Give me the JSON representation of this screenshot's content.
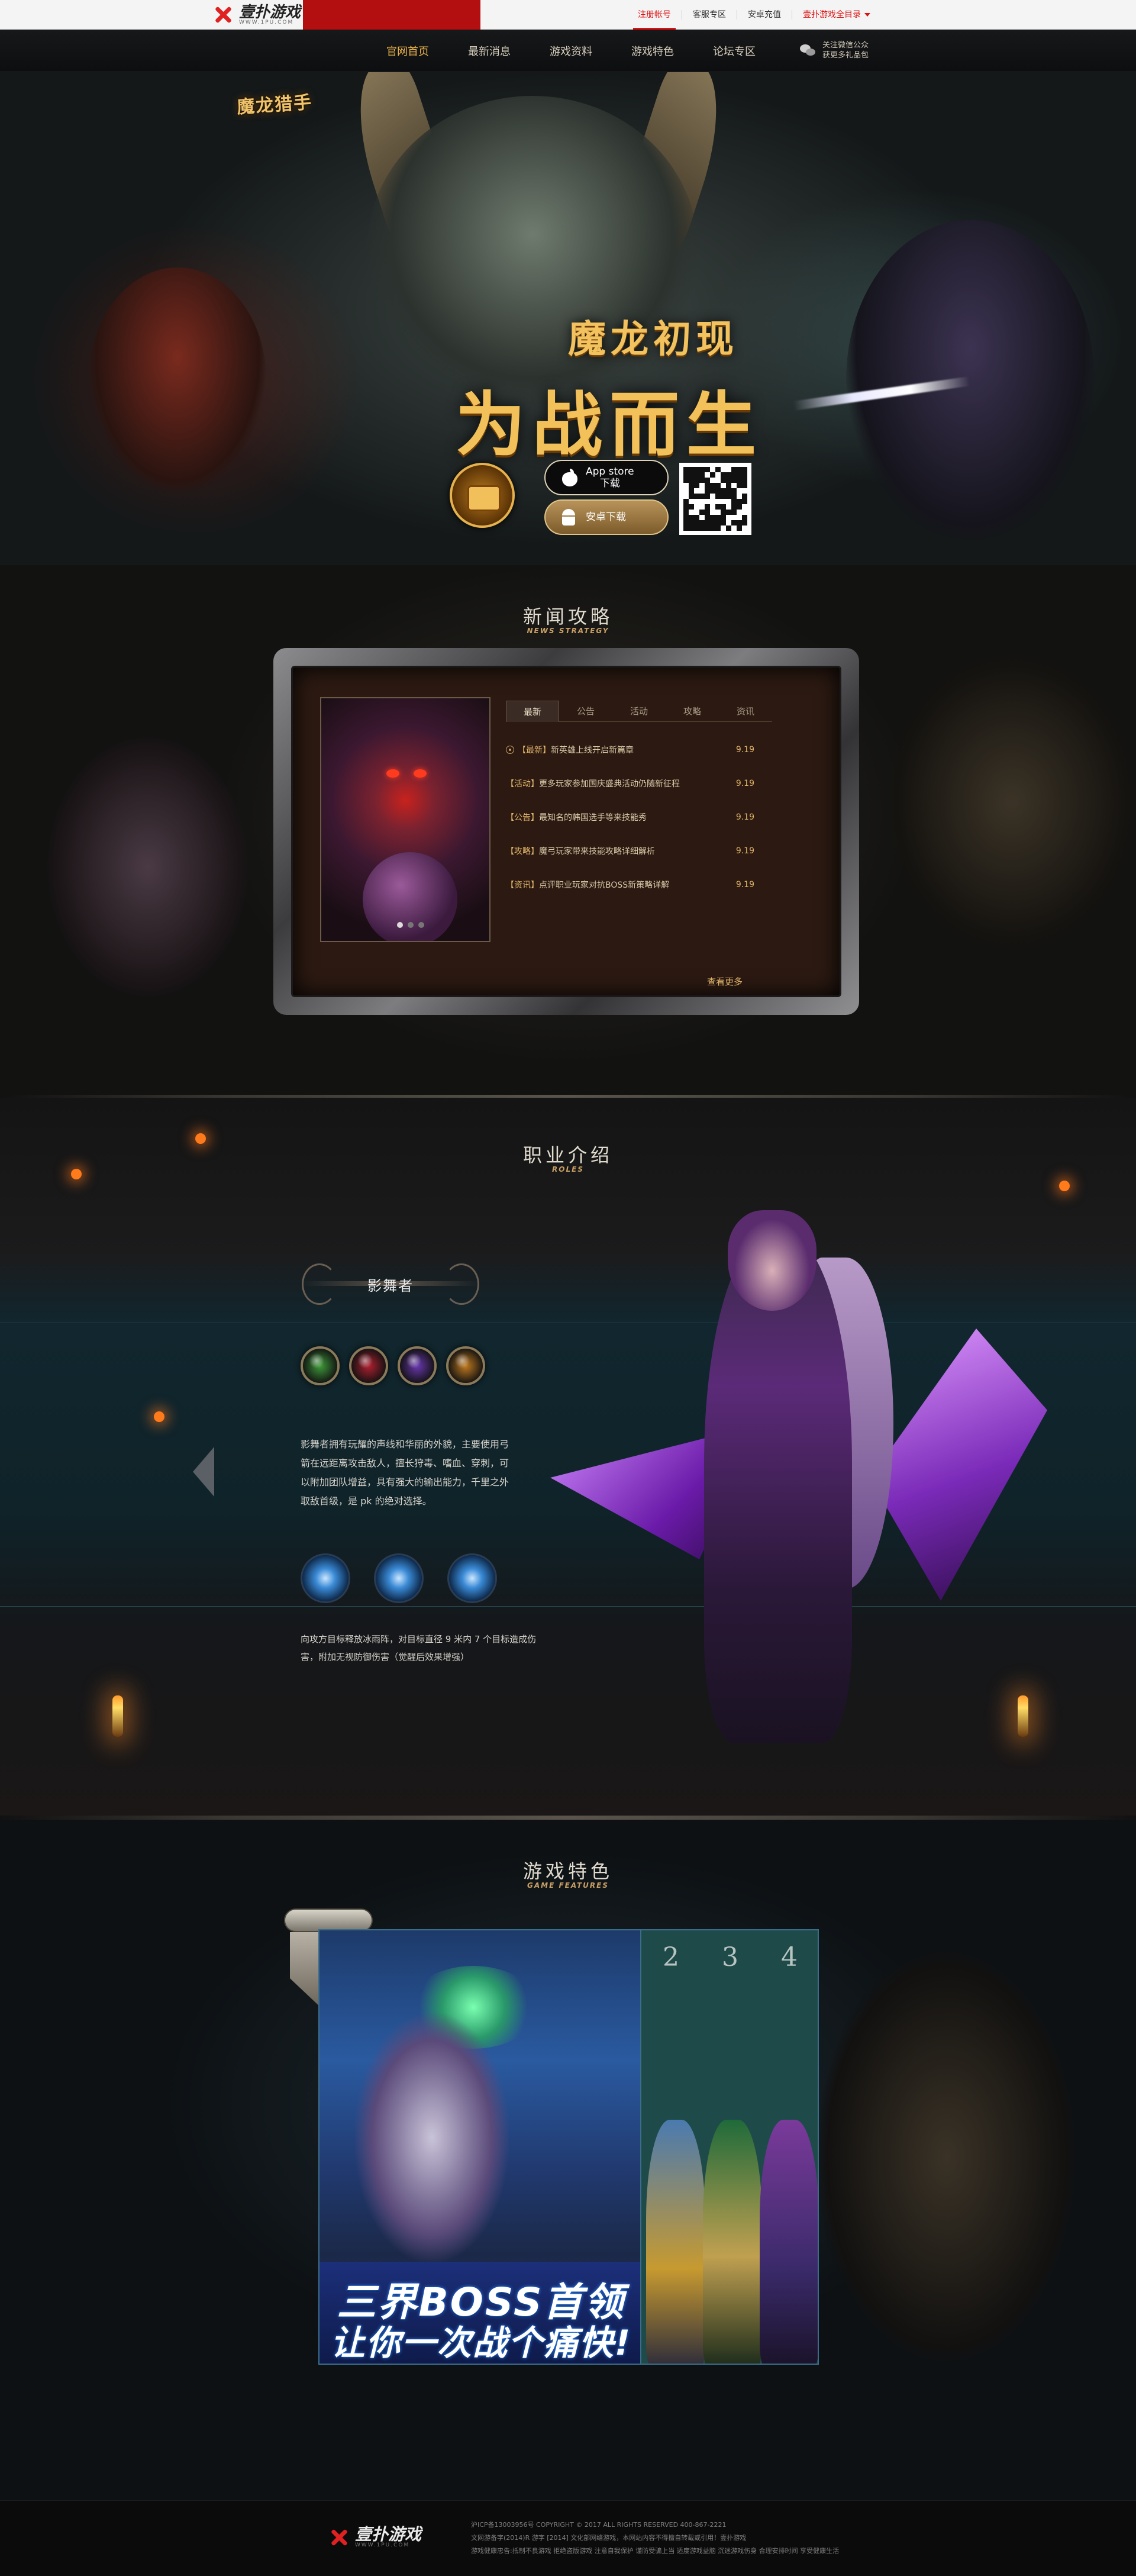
{
  "topbar": {
    "logo_name": "壹扑游戏",
    "logo_url": "WWW.1PU.COM",
    "links": [
      "注册帐号",
      "客服专区",
      "安卓充值",
      "壹扑游戏全目录"
    ]
  },
  "nav": {
    "items": [
      "官网首页",
      "最新消息",
      "游戏资料",
      "游戏特色",
      "论坛专区"
    ],
    "wechat": [
      "关注微信公众",
      "获更多礼品包"
    ]
  },
  "hero": {
    "logo": "魔龙猎手",
    "subtitle": "魔龙初现",
    "title": "为战而生",
    "appstore_label": "App store",
    "appstore_sub": "下载",
    "android_label": "安卓下载"
  },
  "news": {
    "title": "新闻攻略",
    "title_en": "NEWS STRATEGY",
    "tabs": [
      "最新",
      "公告",
      "活动",
      "攻略",
      "资讯"
    ],
    "items": [
      {
        "cat": "【最新】",
        "title": "新英雄上线开启新篇章",
        "date": "9.19"
      },
      {
        "cat": "【活动】",
        "title": "更多玩家参加国庆盛典活动仍随新征程",
        "date": "9.19"
      },
      {
        "cat": "【公告】",
        "title": "最知名的韩国选手等来技能秀",
        "date": "9.19"
      },
      {
        "cat": "【攻略】",
        "title": "魔弓玩家带来技能攻略详细解析",
        "date": "9.19"
      },
      {
        "cat": "【资讯】",
        "title": "点评职业玩家对抗BOSS新策略详解",
        "date": "9.19"
      }
    ],
    "more": "查看更多"
  },
  "roles": {
    "title": "职业介绍",
    "title_en": "ROLES",
    "name": "影舞者",
    "gems": [
      {
        "name": "role-tab-green",
        "color": "#3f9a3a"
      },
      {
        "name": "role-tab-red",
        "color": "#b02030"
      },
      {
        "name": "role-tab-purple",
        "color": "#6a38b0"
      },
      {
        "name": "role-tab-orange",
        "color": "#c27a20"
      }
    ],
    "description": "影舞者拥有玩耀的声线和华丽的外貌，主要使用弓箭在远距离攻击敌人，擅长狩毒、嗜血、穿刺，可以附加团队增益，具有强大的输出能力，千里之外取敌首级，是 pk 的绝对选择。",
    "skill_description": "向攻方目标释放冰雨阵，对目标直径 9 米内 7 个目标造成伤害，附加无视防御伤害（觉醒后效果增强）"
  },
  "features": {
    "title": "游戏特色",
    "title_en": "GAME FEATURES",
    "banner_line1": "三界BOSS首领",
    "banner_line2": "让你一次战个痛快!",
    "numbers": [
      "2",
      "3",
      "4"
    ]
  },
  "footer": {
    "logo_name": "壹扑游戏",
    "logo_url": "WWW.1PU.COM",
    "lines": [
      "沪ICP备13003956号 COPYRIGHT © 2017 ALL RIGHTS RESERVED    400-867-2221",
      "文网游备字(2014)R 游字 [2014] 文化部网络游戏，本网站内容不得擅自转载或引用！壹扑游戏",
      "游戏健康忠告:抵制不良游戏 拒绝盗版游戏 注意自我保护 谨防受骗上当 适度游戏益脑 沉迷游戏伤身 合理安排时间 享受健康生活"
    ]
  }
}
